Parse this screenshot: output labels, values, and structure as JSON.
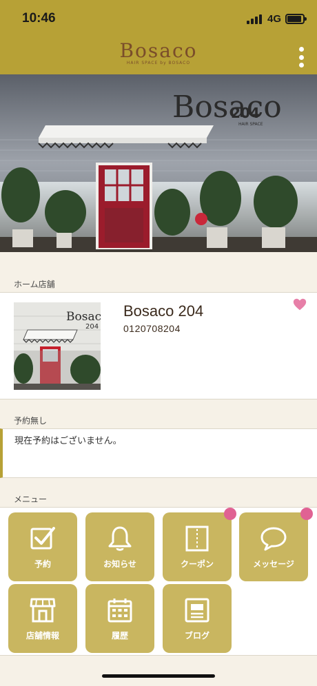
{
  "status_bar": {
    "time": "10:46",
    "network": "4G"
  },
  "header": {
    "logo_text": "Bosaco",
    "logo_sub": "HAIR SPACE by BOSACO"
  },
  "hero": {
    "sign_text": "Bosaco",
    "sign_number": "204",
    "sign_sub": "HAIR SPACE"
  },
  "home_store": {
    "section_label": "ホーム店舗",
    "name": "Bosaco 204",
    "phone": "0120708204",
    "thumb_sign": "Bosaco",
    "thumb_number": "204"
  },
  "reservation": {
    "section_label": "予約無し",
    "message": "現在予約はございません。"
  },
  "menu": {
    "section_label": "メニュー",
    "items": [
      {
        "label": "予約",
        "icon": "checkbox-icon",
        "badge": false
      },
      {
        "label": "お知らせ",
        "icon": "bell-icon",
        "badge": false
      },
      {
        "label": "クーポン",
        "icon": "coupon-icon",
        "badge": true
      },
      {
        "label": "メッセージ",
        "icon": "speech-bubble-icon",
        "badge": true
      },
      {
        "label": "店舗情報",
        "icon": "storefront-icon",
        "badge": false
      },
      {
        "label": "履歴",
        "icon": "calendar-icon",
        "badge": false
      },
      {
        "label": "ブログ",
        "icon": "blog-icon",
        "badge": false
      }
    ]
  },
  "colors": {
    "header": "#b7a136",
    "tile": "#c9b660",
    "badge": "#e06293",
    "heart": "#e77fa8",
    "background": "#f6f1e7"
  }
}
